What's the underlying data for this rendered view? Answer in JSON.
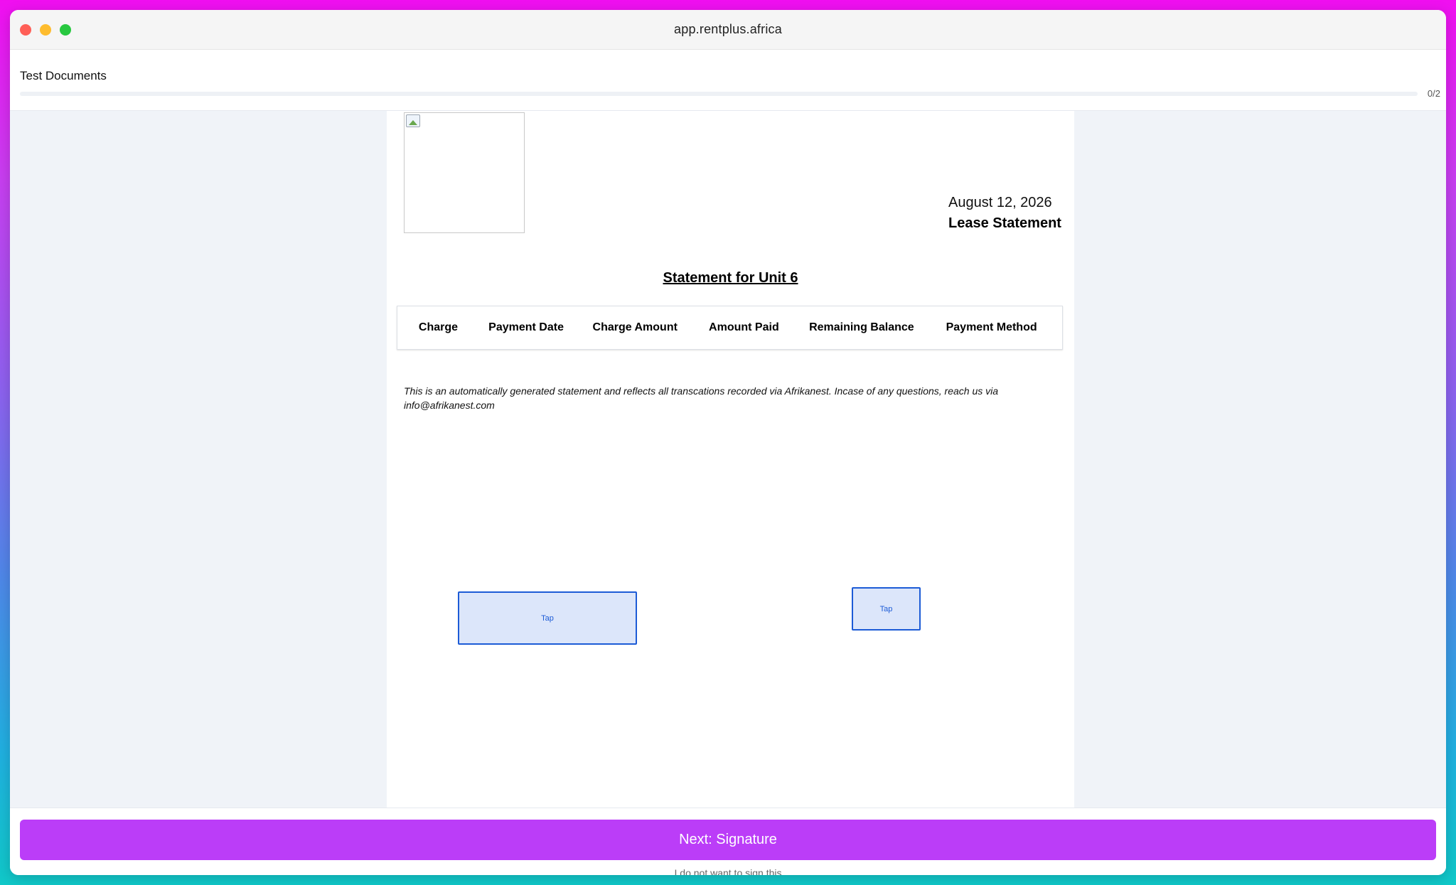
{
  "window": {
    "title": "app.rentplus.africa"
  },
  "header": {
    "document_title": "Test Documents",
    "progress_count": "0/2",
    "progress_fraction": 0
  },
  "document": {
    "date": "August 12, 2026",
    "type": "Lease Statement",
    "statement_title": "Statement for Unit 6",
    "table": {
      "headers": [
        "Charge",
        "Payment Date",
        "Charge Amount",
        "Amount Paid",
        "Remaining Balance",
        "Payment Method"
      ],
      "rows": []
    },
    "disclaimer": "This is an automatically generated statement and reflects all transcations recorded via Afrikanest. Incase of any questions, reach us via info@afrikanest.com",
    "fields": [
      {
        "label": "Tap"
      },
      {
        "label": "Tap"
      }
    ]
  },
  "footer": {
    "next_button": "Next: Signature",
    "decline_link": "I do not want to sign this"
  },
  "colors": {
    "accent": "#bb3df8",
    "field_border": "#1c5bd6",
    "field_fill": "#dce6fa"
  },
  "icons": {
    "window_controls": [
      "close-icon",
      "minimize-icon",
      "zoom-icon"
    ],
    "logo": "broken-image-icon"
  }
}
